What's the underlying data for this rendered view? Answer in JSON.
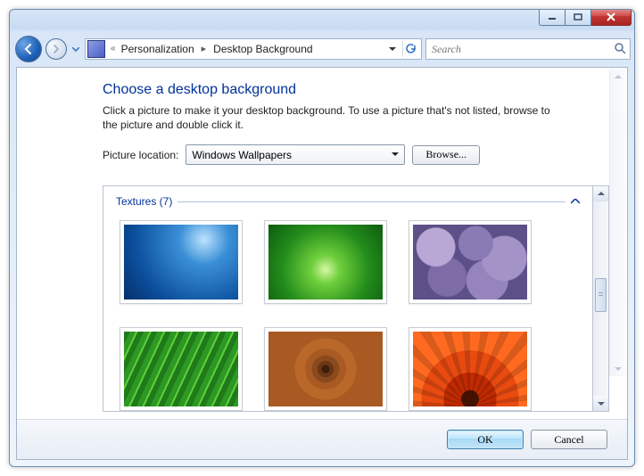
{
  "window": {
    "caption_buttons": {
      "minimize": "–",
      "maximize": "❐",
      "close": "✕"
    }
  },
  "nav": {
    "address": {
      "double_chevron": "«",
      "parts": [
        "Personalization",
        "Desktop Background"
      ],
      "separator": "▸"
    },
    "search_placeholder": "Search"
  },
  "content": {
    "heading": "Choose a desktop background",
    "description": "Click a picture to make it your desktop background. To use a picture that's not listed, browse to the picture and double click it.",
    "picture_location_label": "Picture location:",
    "dropdown_value": "Windows Wallpapers",
    "browse_label": "Browse...",
    "group_header": "Textures (7)",
    "thumbs": [
      {
        "name": "thumb-fish"
      },
      {
        "name": "thumb-grass"
      },
      {
        "name": "thumb-stones"
      },
      {
        "name": "thumb-leaf"
      },
      {
        "name": "thumb-wood"
      },
      {
        "name": "thumb-flower"
      }
    ]
  },
  "footer": {
    "ok_label": "OK",
    "cancel_label": "Cancel"
  }
}
